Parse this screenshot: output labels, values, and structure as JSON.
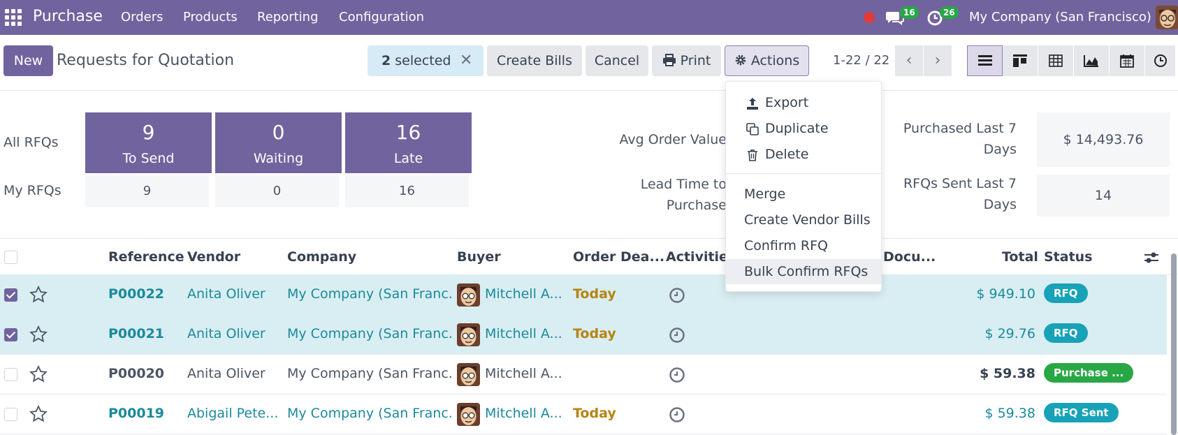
{
  "navbar": {
    "app_name": "Purchase",
    "menus": [
      "Orders",
      "Products",
      "Reporting",
      "Configuration"
    ],
    "chat_badge": "16",
    "activity_badge": "26",
    "company": "My Company (San Francisco)"
  },
  "control_panel": {
    "new_label": "New",
    "title": "Requests for Quotation",
    "selected_count": "2",
    "selected_label": "selected",
    "create_bills_label": "Create Bills",
    "cancel_label": "Cancel",
    "print_label": "Print",
    "actions_label": "Actions",
    "pager": "1-22 / 22"
  },
  "dashboard": {
    "all_rfqs_label": "All RFQs",
    "my_rfqs_label": "My RFQs",
    "tiles": [
      {
        "value": "9",
        "label": "To Send"
      },
      {
        "value": "0",
        "label": "Waiting"
      },
      {
        "value": "16",
        "label": "Late"
      }
    ],
    "my_values": [
      "9",
      "0",
      "16"
    ],
    "avg_order_label": "Avg Order Value",
    "lead_time_label_1": "Lead Time to",
    "lead_time_label_2": "Purchase",
    "purchased_label_1": "Purchased Last 7",
    "purchased_label_2": "Days",
    "purchased_value": "$ 14,493.76",
    "rfqs_sent_label_1": "RFQs Sent Last 7",
    "rfqs_sent_label_2": "Days",
    "rfqs_sent_value": "14"
  },
  "actions_menu": {
    "items": [
      "Export",
      "Duplicate",
      "Delete",
      "Merge",
      "Create Vendor Bills",
      "Confirm RFQ",
      "Bulk Confirm RFQs"
    ],
    "icons": [
      "upload-icon",
      "duplicate-icon",
      "trash-icon"
    ]
  },
  "table": {
    "headers": [
      "Reference",
      "Vendor",
      "Company",
      "Buyer",
      "Order Dea...",
      "Activities",
      "Docu...",
      "Total",
      "Status"
    ],
    "rows": [
      {
        "reference": "P00022",
        "vendor": "Anita Oliver",
        "company": "My Company (San Franc...",
        "buyer": "Mitchell A...",
        "deadline": "Today",
        "total": "$ 949.10",
        "status": "RFQ",
        "checked": true,
        "status_color": "#17a2b8"
      },
      {
        "reference": "P00021",
        "vendor": "Anita Oliver",
        "company": "My Company (San Franc...",
        "buyer": "Mitchell A...",
        "deadline": "Today",
        "total": "$ 29.76",
        "status": "RFQ",
        "checked": true,
        "status_color": "#17a2b8"
      },
      {
        "reference": "P00020",
        "vendor": "Anita Oliver",
        "company": "My Company (San Franc...",
        "buyer": "Mitchell A...",
        "deadline": "",
        "total": "$ 59.38",
        "status": "Purchase ...",
        "checked": false,
        "status_color": "#28a745"
      },
      {
        "reference": "P00019",
        "vendor": "Abigail Pete...",
        "company": "My Company (San Franc...",
        "buyer": "Mitchell A...",
        "deadline": "Today",
        "total": "$ 59.38",
        "status": "RFQ Sent",
        "checked": false,
        "status_color": "#17a2b8"
      }
    ]
  },
  "colors": {
    "brand": "#71639e",
    "link": "#1a8a9c",
    "today": "#b5840f",
    "selected_row": "#d9eef2"
  }
}
